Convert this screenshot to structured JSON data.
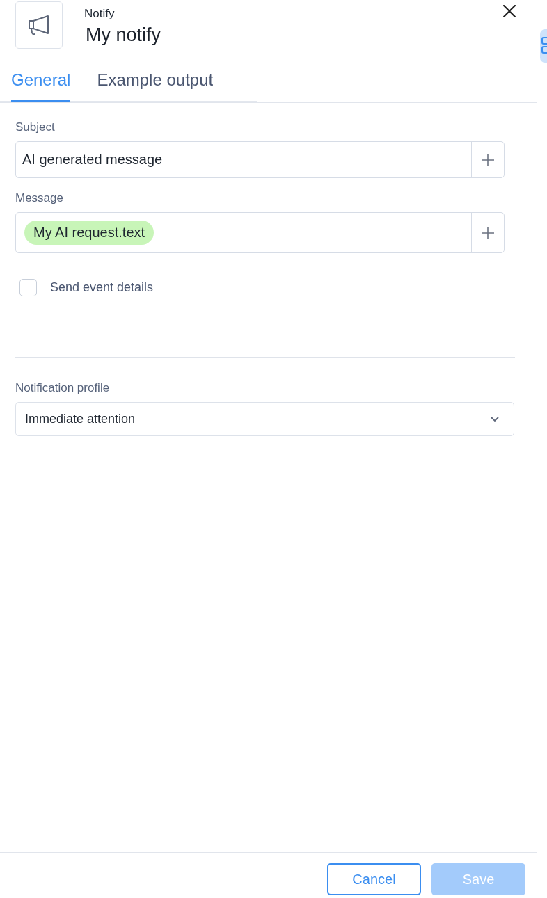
{
  "header": {
    "subtitle": "Notify",
    "title": "My notify"
  },
  "tabs": [
    {
      "label": "General",
      "selected": true
    },
    {
      "label": "Example output",
      "selected": false
    }
  ],
  "fields": [
    {
      "kind": "text",
      "label": "Subject",
      "value": "AI generated message"
    },
    {
      "kind": "tokens",
      "label": "Message",
      "tokens": [
        "My AI request.text"
      ]
    }
  ],
  "checkbox": {
    "label": "Send event details",
    "checked": false
  },
  "notification_profile": {
    "label": "Notification profile",
    "value": "Immediate attention"
  },
  "buttons": [
    {
      "label": "Cancel",
      "kind": "secondary",
      "disabled": false
    },
    {
      "label": "Save",
      "kind": "primary",
      "disabled": true
    }
  ]
}
